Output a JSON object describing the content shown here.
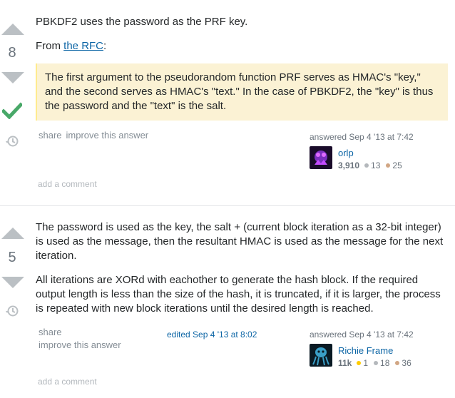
{
  "answers": [
    {
      "votes": "8",
      "accepted": true,
      "paragraph1": "PBKDF2 uses the password as the PRF key.",
      "from_prefix": "From ",
      "from_link": "the RFC",
      "from_suffix": ":",
      "quote": "The first argument to the pseudorandom function PRF serves as HMAC's \"key,\" and the second serves as HMAC's \"text.\" In the case of PBKDF2, the \"key\" is thus the password and the \"text\" is the salt.",
      "menu": {
        "share": "share",
        "improve": "improve this answer"
      },
      "answered_label": "answered Sep 4 '13 at 7:42",
      "user": {
        "name": "orlp",
        "reputation": "3,910",
        "silver": "13",
        "bronze": "25"
      },
      "add_comment": "add a comment"
    },
    {
      "votes": "5",
      "accepted": false,
      "paragraph1": "The password is used as the key, the salt + (current block iteration as a 32-bit integer) is used as the message, then the resultant HMAC is used as the message for the next iteration.",
      "paragraph2": "All iterations are XORd with eachother to generate the hash block. If the required output length is less than the size of the hash, it is truncated, if it is larger, the process is repeated with new block iterations until the desired length is reached.",
      "menu": {
        "share": "share",
        "improve": "improve this answer"
      },
      "edited_label": "edited Sep 4 '13 at 8:02",
      "answered_label": "answered Sep 4 '13 at 7:42",
      "user": {
        "name": "Richie Frame",
        "reputation": "11k",
        "gold": "1",
        "silver": "18",
        "bronze": "36"
      },
      "add_comment": "add a comment"
    }
  ],
  "colors": {
    "accent_link": "#0c65a5",
    "accepted_check": "#48a868",
    "vote_arrow": "#bbc0c4",
    "quote_bg": "#fbf2d4"
  }
}
